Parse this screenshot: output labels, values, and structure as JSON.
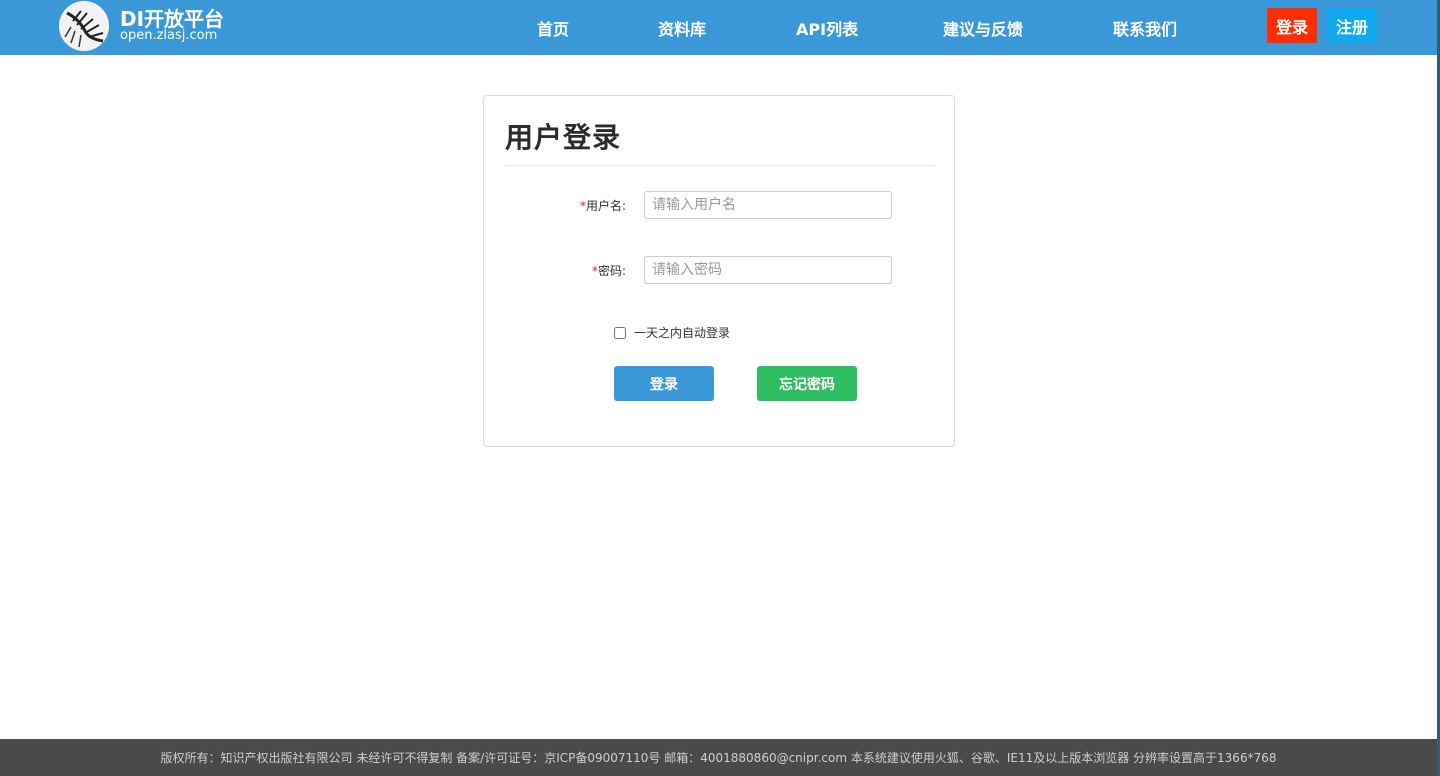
{
  "header": {
    "brand_title": "DI开放平台",
    "brand_subtitle": "open.zlasj.com",
    "nav": [
      {
        "label": "首页"
      },
      {
        "label": "资料库"
      },
      {
        "label": "API列表"
      },
      {
        "label": "建议与反馈"
      },
      {
        "label": "联系我们"
      }
    ],
    "login_label": "登录",
    "register_label": "注册"
  },
  "login_form": {
    "title": "用户登录",
    "required_mark": "*",
    "username_label": "用户名:",
    "username_placeholder": "请输入用户名",
    "username_value": "",
    "password_label": "密码:",
    "password_placeholder": "请输入密码",
    "password_value": "",
    "remember_label": "一天之内自动登录",
    "remember_checked": false,
    "submit_label": "登录",
    "forgot_label": "忘记密码"
  },
  "footer": {
    "text": "版权所有：知识产权出版社有限公司    未经许可不得复制  备案/许可证号：京ICP备09007110号  邮箱：4001880860@cnipr.com  本系统建议使用火狐、谷歌、IE11及以上版本浏览器 分辨率设置高于1366*768"
  },
  "colors": {
    "header_bg": "#3a98d8",
    "login_accent": "#ff2d00",
    "register_accent": "#11a9ee",
    "submit_button": "#3a98d8",
    "forgot_button": "#2dbe60",
    "footer_bg": "#4a4a4a"
  }
}
